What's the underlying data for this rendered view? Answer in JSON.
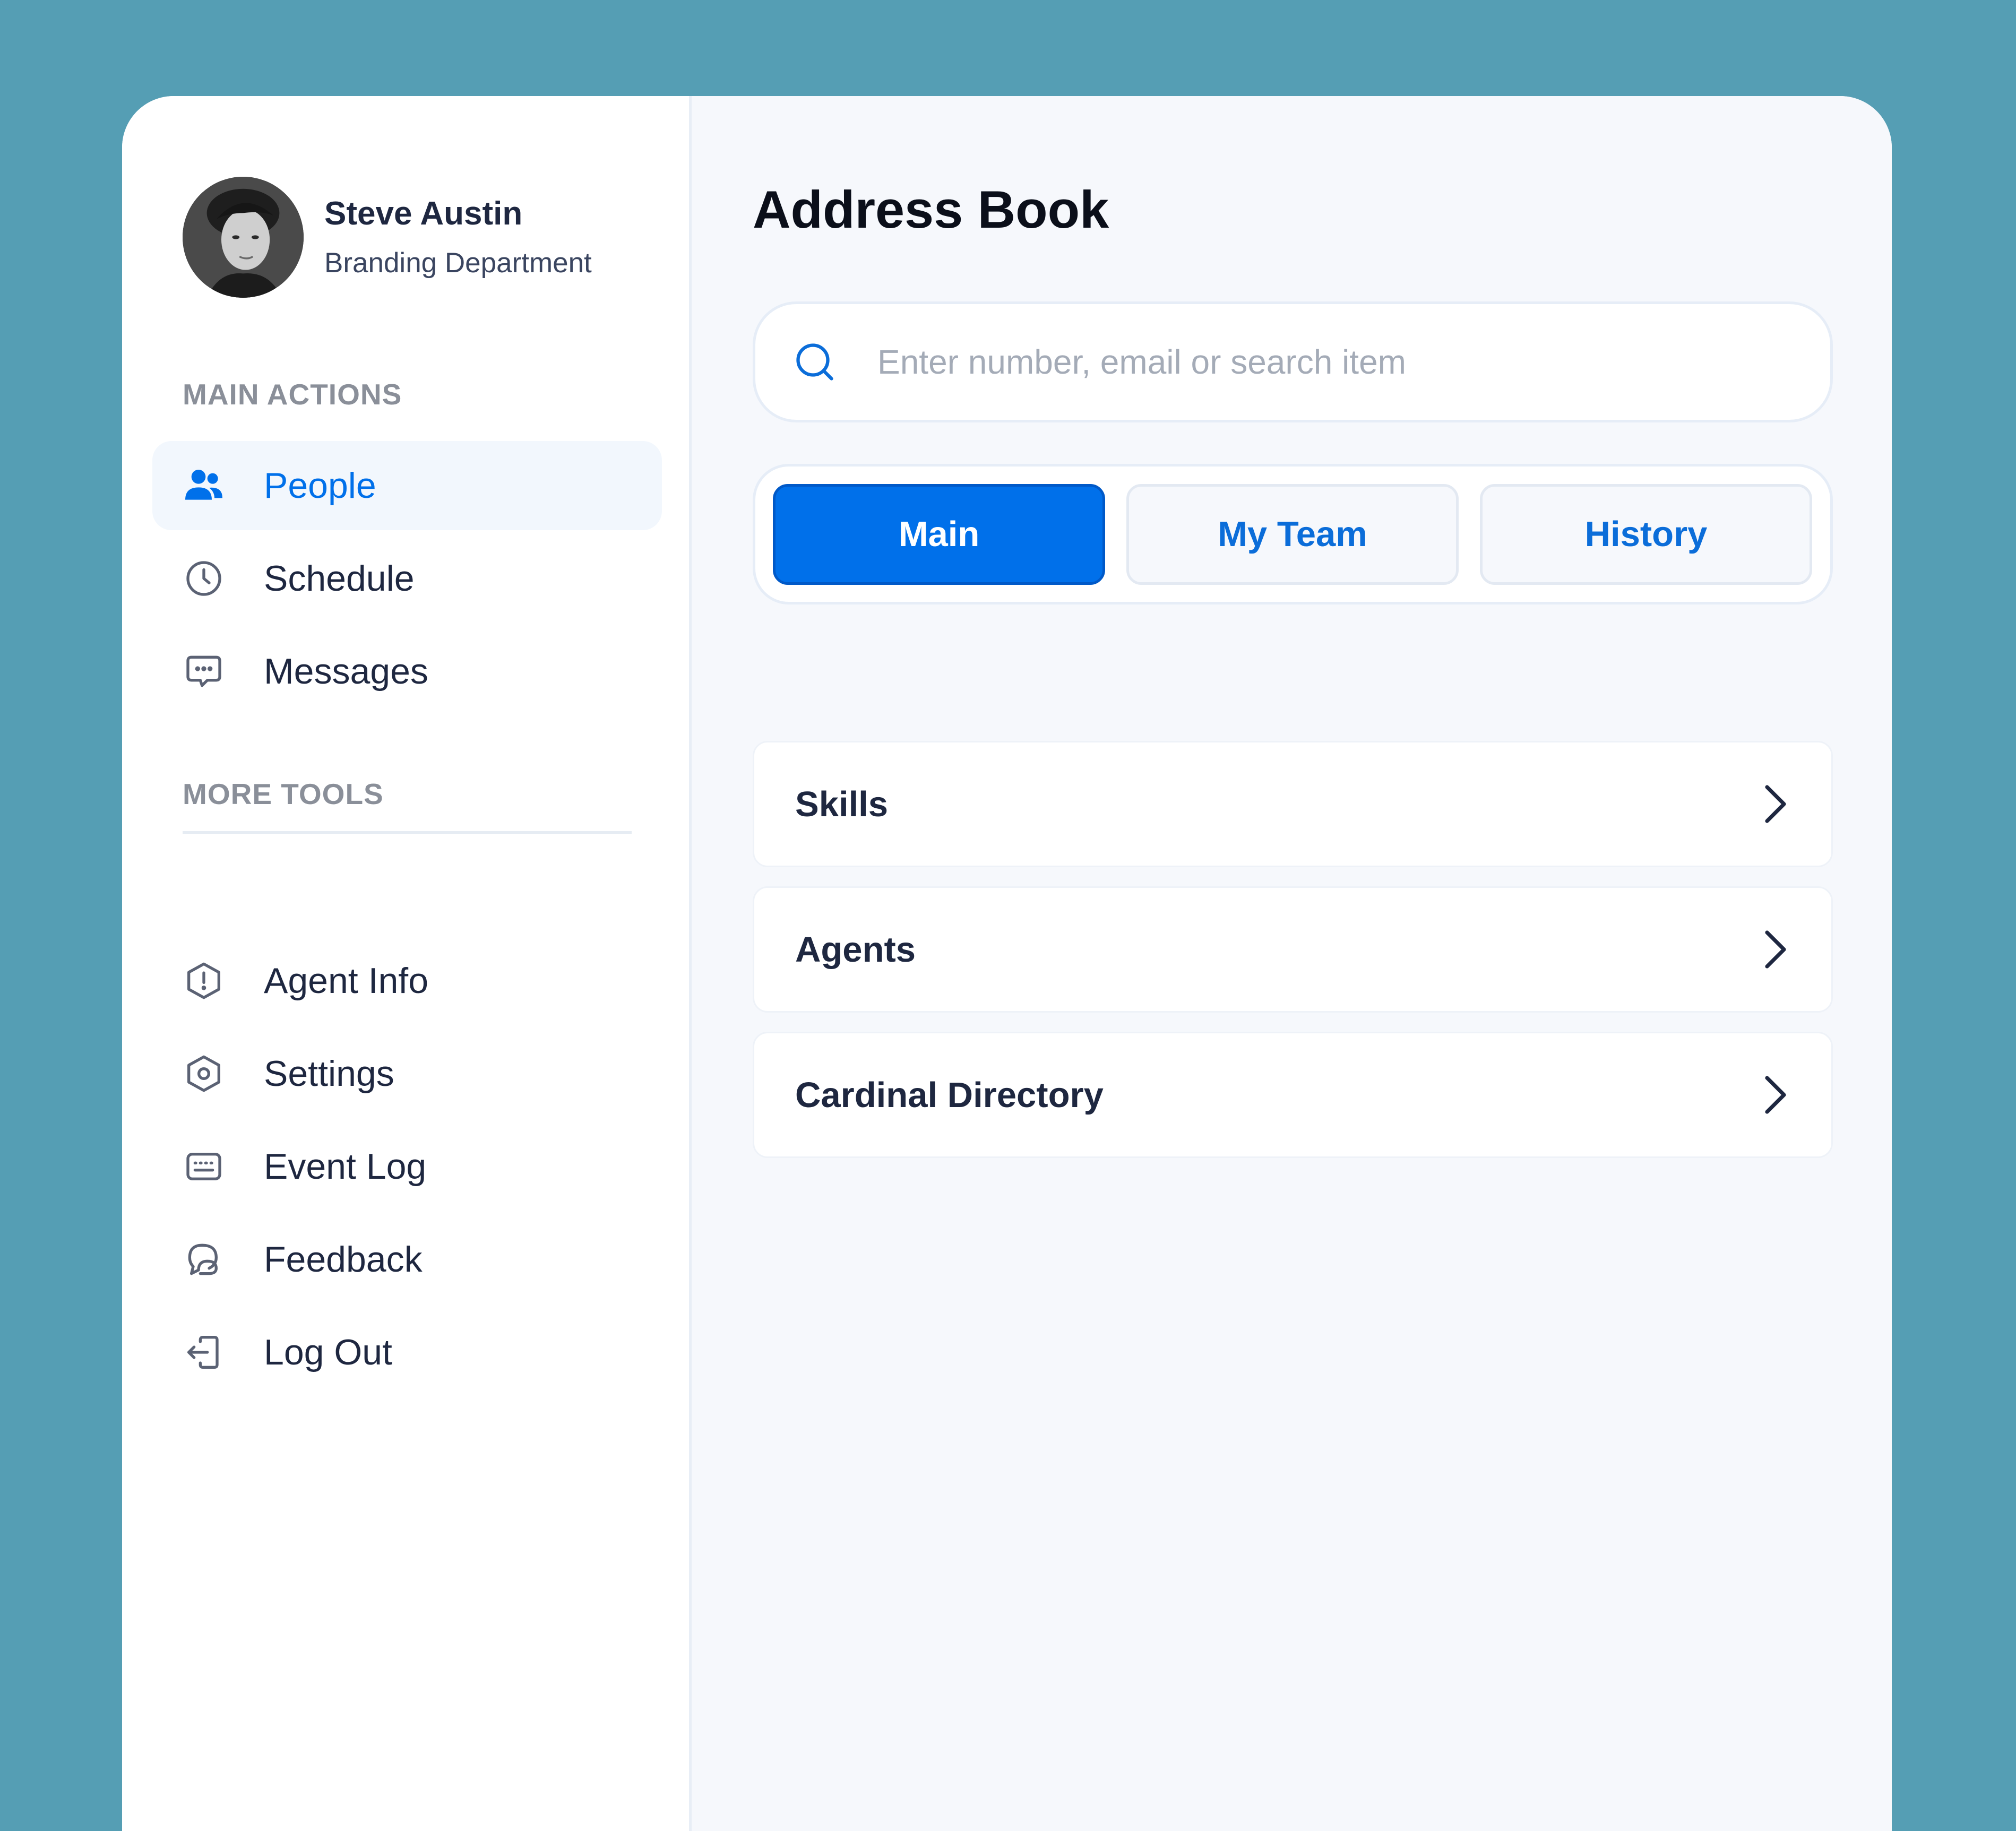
{
  "profile": {
    "name": "Steve Austin",
    "department": "Branding Department"
  },
  "sidebar": {
    "main_actions_title": "MAIN ACTIONS",
    "main_actions": [
      {
        "label": "People",
        "icon": "people-icon",
        "active": true
      },
      {
        "label": "Schedule",
        "icon": "clock-icon",
        "active": false
      },
      {
        "label": "Messages",
        "icon": "message-icon",
        "active": false
      }
    ],
    "more_tools_title": "MORE TOOLS",
    "more_tools": [
      {
        "label": "Agent Info",
        "icon": "alert-hexagon-icon"
      },
      {
        "label": "Settings",
        "icon": "settings-hexagon-icon"
      },
      {
        "label": "Event Log",
        "icon": "log-list-icon"
      },
      {
        "label": "Feedback",
        "icon": "feedback-chat-icon"
      },
      {
        "label": "Log Out",
        "icon": "logout-icon"
      }
    ]
  },
  "main": {
    "title": "Address Book",
    "search": {
      "placeholder": "Enter number, email or search item",
      "value": ""
    },
    "tabs": [
      {
        "label": "Main",
        "active": true
      },
      {
        "label": "My Team",
        "active": false
      },
      {
        "label": "History",
        "active": false
      }
    ],
    "list": [
      {
        "label": "Skills"
      },
      {
        "label": "Agents"
      },
      {
        "label": "Cardinal Directory"
      }
    ]
  },
  "colors": {
    "background": "#559EB4",
    "accent": "#0070EA",
    "text_dark": "#1E2740",
    "muted": "#8A8F99"
  }
}
